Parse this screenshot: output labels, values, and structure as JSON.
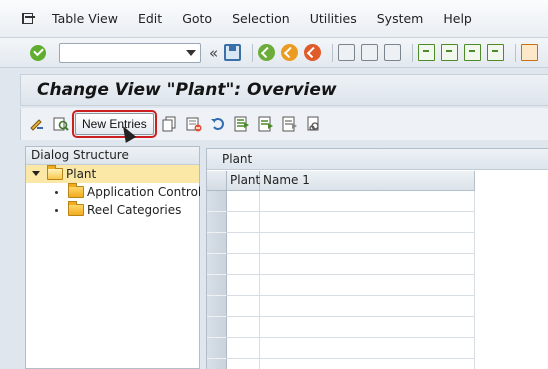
{
  "menu": {
    "items": [
      "Table View",
      "Edit",
      "Goto",
      "Selection",
      "Utilities",
      "System",
      "Help"
    ]
  },
  "toolbar": {
    "command_field_value": "",
    "icons": [
      "enter-icon",
      "save-icon",
      "back-icon",
      "exit-icon",
      "cancel-icon",
      "print-icon",
      "find-icon",
      "find-next-icon",
      "first-page-icon",
      "previous-page-icon",
      "next-page-icon",
      "last-page-icon",
      "create-session-icon"
    ]
  },
  "page": {
    "title": "Change View \"Plant\": Overview"
  },
  "app_toolbar": {
    "new_entries_label": "New Entries",
    "icons": [
      "display-change-icon",
      "details-icon",
      "copy-as-icon",
      "delete-icon",
      "undo-change-icon",
      "select-all-icon",
      "select-block-icon",
      "deselect-all-icon",
      "print-list-icon"
    ]
  },
  "dialog_structure": {
    "header": "Dialog Structure",
    "items": [
      {
        "label": "Plant",
        "selected": true,
        "level": 0
      },
      {
        "label": "Application Control",
        "selected": false,
        "level": 1
      },
      {
        "label": "Reel Categories",
        "selected": false,
        "level": 1
      }
    ]
  },
  "table": {
    "caption": "Plant",
    "columns": [
      "Plant",
      "Name 1"
    ],
    "rows": [
      [
        "",
        ""
      ],
      [
        "",
        ""
      ],
      [
        "",
        ""
      ],
      [
        "",
        ""
      ],
      [
        "",
        ""
      ],
      [
        "",
        ""
      ],
      [
        "",
        ""
      ],
      [
        "",
        ""
      ],
      [
        "",
        ""
      ]
    ]
  },
  "colors": {
    "accent_green": "#5fae2f",
    "highlight_red": "#cc1f1f",
    "tree_selected": "#fbe8a6",
    "folder": "#f1ac1d"
  }
}
